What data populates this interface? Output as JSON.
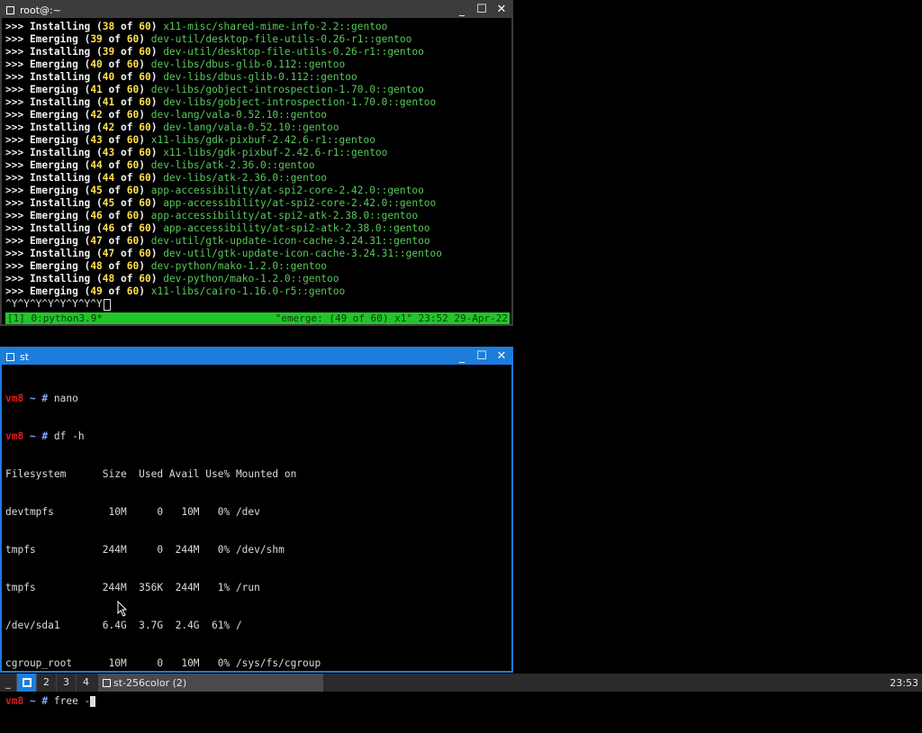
{
  "windows": {
    "top": {
      "title": "root@:~",
      "term_lines": [
        {
          "verb": "Installing",
          "cur": "38",
          "total": "60",
          "pkg": "x11-misc/shared-mime-info-2.2::gentoo"
        },
        {
          "verb": "Emerging",
          "cur": "39",
          "total": "60",
          "pkg": "dev-util/desktop-file-utils-0.26-r1::gentoo"
        },
        {
          "verb": "Installing",
          "cur": "39",
          "total": "60",
          "pkg": "dev-util/desktop-file-utils-0.26-r1::gentoo"
        },
        {
          "verb": "Emerging",
          "cur": "40",
          "total": "60",
          "pkg": "dev-libs/dbus-glib-0.112::gentoo"
        },
        {
          "verb": "Installing",
          "cur": "40",
          "total": "60",
          "pkg": "dev-libs/dbus-glib-0.112::gentoo"
        },
        {
          "verb": "Emerging",
          "cur": "41",
          "total": "60",
          "pkg": "dev-libs/gobject-introspection-1.70.0::gentoo"
        },
        {
          "verb": "Installing",
          "cur": "41",
          "total": "60",
          "pkg": "dev-libs/gobject-introspection-1.70.0::gentoo"
        },
        {
          "verb": "Emerging",
          "cur": "42",
          "total": "60",
          "pkg": "dev-lang/vala-0.52.10::gentoo"
        },
        {
          "verb": "Installing",
          "cur": "42",
          "total": "60",
          "pkg": "dev-lang/vala-0.52.10::gentoo"
        },
        {
          "verb": "Emerging",
          "cur": "43",
          "total": "60",
          "pkg": "x11-libs/gdk-pixbuf-2.42.6-r1::gentoo"
        },
        {
          "verb": "Installing",
          "cur": "43",
          "total": "60",
          "pkg": "x11-libs/gdk-pixbuf-2.42.6-r1::gentoo"
        },
        {
          "verb": "Emerging",
          "cur": "44",
          "total": "60",
          "pkg": "dev-libs/atk-2.36.0::gentoo"
        },
        {
          "verb": "Installing",
          "cur": "44",
          "total": "60",
          "pkg": "dev-libs/atk-2.36.0::gentoo"
        },
        {
          "verb": "Emerging",
          "cur": "45",
          "total": "60",
          "pkg": "app-accessibility/at-spi2-core-2.42.0::gentoo"
        },
        {
          "verb": "Installing",
          "cur": "45",
          "total": "60",
          "pkg": "app-accessibility/at-spi2-core-2.42.0::gentoo"
        },
        {
          "verb": "Emerging",
          "cur": "46",
          "total": "60",
          "pkg": "app-accessibility/at-spi2-atk-2.38.0::gentoo"
        },
        {
          "verb": "Installing",
          "cur": "46",
          "total": "60",
          "pkg": "app-accessibility/at-spi2-atk-2.38.0::gentoo"
        },
        {
          "verb": "Emerging",
          "cur": "47",
          "total": "60",
          "pkg": "dev-util/gtk-update-icon-cache-3.24.31::gentoo"
        },
        {
          "verb": "Installing",
          "cur": "47",
          "total": "60",
          "pkg": "dev-util/gtk-update-icon-cache-3.24.31::gentoo"
        },
        {
          "verb": "Emerging",
          "cur": "48",
          "total": "60",
          "pkg": "dev-python/mako-1.2.0::gentoo"
        },
        {
          "verb": "Installing",
          "cur": "48",
          "total": "60",
          "pkg": "dev-python/mako-1.2.0::gentoo"
        },
        {
          "verb": "Emerging",
          "cur": "49",
          "total": "60",
          "pkg": "x11-libs/cairo-1.16.0-r5::gentoo"
        }
      ],
      "prefix": ">>> ",
      "open_paren": " (",
      "of_word": " of ",
      "close_paren": ") ",
      "input_line": "^Y^Y^Y^Y^Y^Y^Y^Y",
      "tmux_left": "[1] 0:python3.9*",
      "tmux_right": "\"emerge: (49 of 60) x1\" 23:52 29-Apr-22"
    },
    "bottom": {
      "title": "st",
      "prompt_host": "vm8",
      "prompt_path": " ~ # ",
      "cmd1": "nano",
      "cmd2": "df -h",
      "df_header": "Filesystem      Size  Used Avail Use% Mounted on",
      "df_rows": [
        "devtmpfs         10M     0   10M   0% /dev",
        "tmpfs           244M     0  244M   0% /dev/shm",
        "tmpfs           244M  356K  244M   1% /run",
        "/dev/sda1       6.4G  3.7G  2.4G  61% /",
        "cgroup_root      10M     0   10M   0% /sys/fs/cgroup"
      ],
      "cmd3": "free -"
    }
  },
  "window_buttons": {
    "minimize": "_",
    "maximize": "☐",
    "close": "✕"
  },
  "taskbar": {
    "menu": "_",
    "workspaces": [
      "2",
      "3",
      "4"
    ],
    "task_label": "st-256color (2)",
    "clock": "23:53"
  },
  "colors": {
    "accent": "#1c7ddb",
    "tmux_status": "#22c62a",
    "package_green": "#58c85a",
    "progress_yellow": "#ffe14d",
    "prompt_red": "#e21c1c"
  }
}
